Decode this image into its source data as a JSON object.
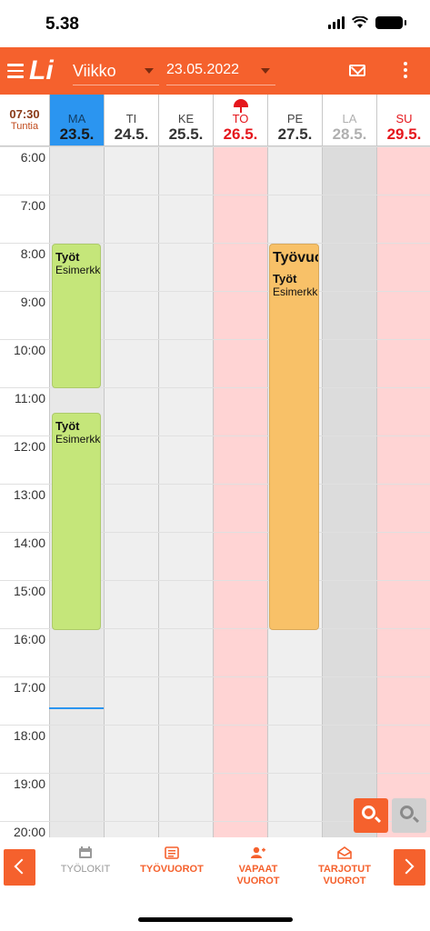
{
  "status": {
    "time": "5.38"
  },
  "toolbar": {
    "logo": "Li",
    "view_select": "Viikko",
    "date_select": "23.05.2022"
  },
  "header": {
    "hours_value": "07:30",
    "hours_label": "Tuntia",
    "days": [
      {
        "name": "MA",
        "date": "23.5."
      },
      {
        "name": "TI",
        "date": "24.5."
      },
      {
        "name": "KE",
        "date": "25.5."
      },
      {
        "name": "TO",
        "date": "26.5."
      },
      {
        "name": "PE",
        "date": "27.5."
      },
      {
        "name": "LA",
        "date": "28.5."
      },
      {
        "name": "SU",
        "date": "29.5."
      }
    ]
  },
  "grid": {
    "hours": [
      "6:00",
      "7:00",
      "8:00",
      "9:00",
      "10:00",
      "11:00",
      "12:00",
      "13:00",
      "14:00",
      "15:00",
      "16:00",
      "17:00",
      "18:00",
      "19:00",
      "20:00"
    ]
  },
  "events": [
    {
      "day": "MA",
      "title": "Työt",
      "subtitle": "Esimerkki",
      "start": "8:00",
      "end": "11:00",
      "color": "#c5e67a"
    },
    {
      "day": "MA",
      "title": "Työt",
      "subtitle": "Esimerkki",
      "start": "11:30",
      "end": "16:00",
      "color": "#c5e67a"
    },
    {
      "day": "PE",
      "title": "Työvuoro",
      "line2": "Työt",
      "subtitle": "Esimerkki",
      "start": "8:00",
      "end": "16:00",
      "color": "#f8c168"
    }
  ],
  "bottom_nav": {
    "tabs": [
      {
        "label": "TYÖLOKIT"
      },
      {
        "label": "TYÖVUOROT"
      },
      {
        "label": "VAPAAT VUOROT"
      },
      {
        "label": "TARJOTUT VUOROT"
      }
    ]
  },
  "colors": {
    "brand": "#f5612d",
    "today": "#2b95f0",
    "holiday": "#e5171d"
  }
}
